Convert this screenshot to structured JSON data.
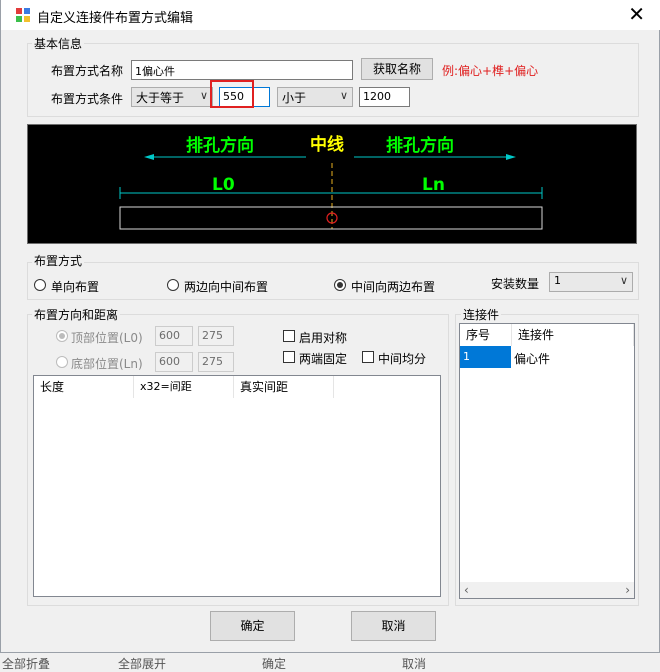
{
  "window": {
    "title": "自定义连接件布置方式编辑"
  },
  "basic": {
    "group_label": "基本信息",
    "name_label": "布置方式名称",
    "name_value": "1偏心件",
    "get_name_button": "获取名称",
    "example_text": "例:偏心+榫+偏心",
    "cond_label": "布置方式条件",
    "cond1_op": "大于等于",
    "cond1_value": "550",
    "cond2_op": "小于",
    "cond2_value": "1200"
  },
  "diagram": {
    "left_dir": "排孔方向",
    "center": "中线",
    "right_dir": "排孔方向",
    "l0": "L0",
    "ln": "Ln"
  },
  "layout_mode": {
    "group_label": "布置方式",
    "opt1": "单向布置",
    "opt2": "两边向中间布置",
    "opt3": "中间向两边布置",
    "selected": "中间向两边布置",
    "qty_label": "安装数量",
    "qty_value": "1"
  },
  "direction": {
    "group_label": "布置方向和距离",
    "top_label": "顶部位置(L0)",
    "top_v1": "600",
    "top_v2": "275",
    "bottom_label": "底部位置(Ln)",
    "bottom_v1": "600",
    "bottom_v2": "275",
    "symmetric": "启用对称",
    "fixed_ends": "两端固定",
    "even_middle": "中间均分",
    "columns": [
      "长度",
      "x32=间距",
      "真实间距"
    ]
  },
  "connectors": {
    "group_label": "连接件",
    "columns": [
      "序号",
      "连接件"
    ],
    "rows": [
      {
        "no": "1",
        "name": "偏心件"
      }
    ]
  },
  "footer": {
    "ok": "确定",
    "cancel": "取消"
  },
  "behind": {
    "b1": "全部折叠",
    "b2": "全部展开",
    "b3": "确定",
    "b4": "取消"
  },
  "colors": {
    "highlight": "#e02020",
    "selection": "#0078d7",
    "cad_green": "#00ff00",
    "cad_yellow": "#ffff00",
    "cad_cyan": "#00c8c8"
  }
}
